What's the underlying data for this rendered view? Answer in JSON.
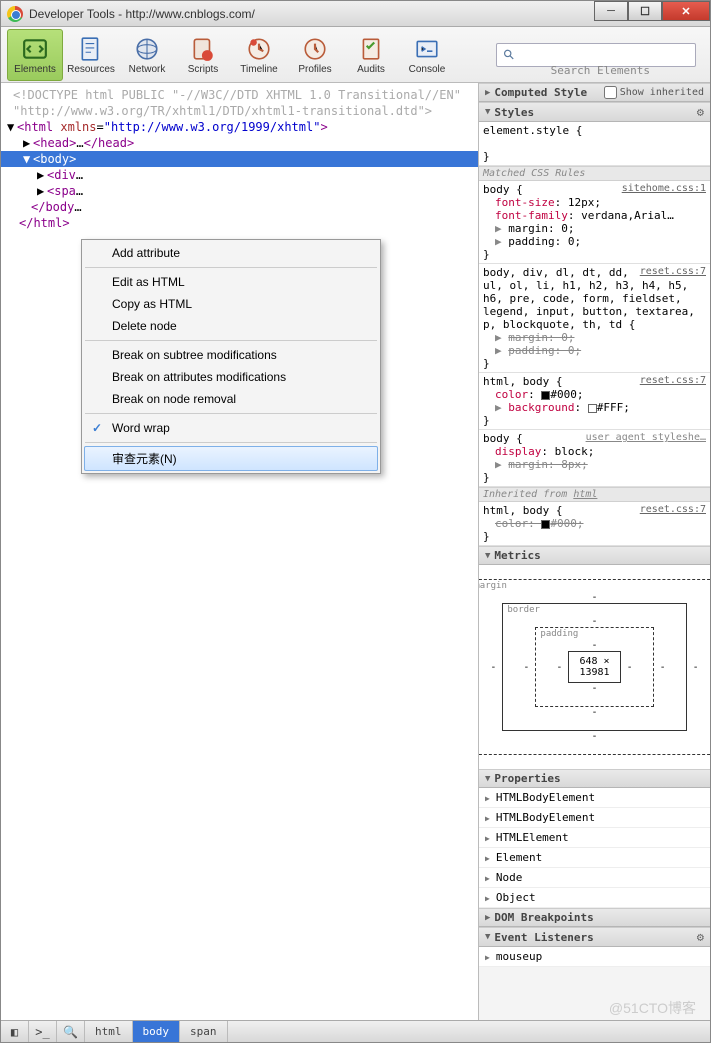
{
  "title": "Developer Tools - http://www.cnblogs.com/",
  "toolbar": [
    {
      "label": "Elements",
      "iconcolor": "#4a9b2f",
      "active": true
    },
    {
      "label": "Resources",
      "iconcolor": "#3b6fb5"
    },
    {
      "label": "Network",
      "iconcolor": "#4a6fa8"
    },
    {
      "label": "Scripts",
      "iconcolor": "#b95c3a"
    },
    {
      "label": "Timeline",
      "iconcolor": "#b95c3a"
    },
    {
      "label": "Profiles",
      "iconcolor": "#b95c3a"
    },
    {
      "label": "Audits",
      "iconcolor": "#b95c3a"
    },
    {
      "label": "Console",
      "iconcolor": "#3b6fb5"
    }
  ],
  "search_placeholder": "",
  "search_label": "Search Elements",
  "dom": {
    "doctype1": "<!DOCTYPE html PUBLIC \"-//W3C//DTD XHTML 1.0 Transitional//EN\"",
    "doctype2": "\"http://www.w3.org/TR/xhtml1/DTD/xhtml1-transitional.dtd\">",
    "html_open": "<html xmlns=\"http://www.w3.org/1999/xhtml\">",
    "head": "<head>…</head>",
    "body_open": "<body>",
    "div": "<div…",
    "spa": "<spa…",
    "body_close": "</body…",
    "html_close": "</html>"
  },
  "context_menu": {
    "items1": [
      "Add attribute"
    ],
    "items2": [
      "Edit as HTML",
      "Copy as HTML",
      "Delete node"
    ],
    "items3": [
      "Break on subtree modifications",
      "Break on attributes modifications",
      "Break on node removal"
    ],
    "check": "Word wrap",
    "highlight": "审查元素(N)"
  },
  "side": {
    "computed": "Computed Style",
    "show_inherited": "Show inherited",
    "styles_hdr": "Styles",
    "element_style": "element.style {",
    "matched_hdr": "Matched CSS Rules",
    "rule1": {
      "sel": "body {",
      "src": "sitehome.css:1",
      "p1n": "font-size",
      "p1v": ": 12px;",
      "p2n": "font-family",
      "p2v": ": verdana,Arial…",
      "p3": "margin: 0;",
      "p4": "padding: 0;"
    },
    "rule2": {
      "src": "reset.css:7",
      "sel": "body, div, dl, dt, dd, ul, ol, li, h1, h2, h3, h4, h5, h6, pre, code, form, fieldset, legend, input, button, textarea, p, blockquote, th, td {",
      "p1": "margin: 0;",
      "p2": "padding: 0;"
    },
    "rule3": {
      "sel": "html, body {",
      "src": "reset.css:7",
      "p1n": "color",
      "p1v": "#000;",
      "p2n": "background",
      "p2v": "#FFF;"
    },
    "rule4": {
      "sel": "body {",
      "src": "user agent styleshe…",
      "p1n": "display",
      "p1v": ": block;",
      "p2": "margin: 8px;"
    },
    "inherited_hdr": "Inherited from ",
    "inherited_from": "html",
    "rule5": {
      "sel": "html, body {",
      "src": "reset.css:7",
      "p1n": "color",
      "p1v": "#000;"
    },
    "metrics_hdr": "Metrics",
    "metrics": {
      "margin": "margin",
      "border": "border",
      "padding": "padding",
      "dims": "648 × 13981"
    },
    "props_hdr": "Properties",
    "props": [
      "HTMLBodyElement",
      "HTMLBodyElement",
      "HTMLElement",
      "Element",
      "Node",
      "Object"
    ],
    "dombp_hdr": "DOM Breakpoints",
    "evlist_hdr": "Event Listeners",
    "evlist": [
      "mouseup"
    ]
  },
  "breadcrumbs": [
    "html",
    "body",
    "span"
  ],
  "watermark": "@51CTO博客"
}
